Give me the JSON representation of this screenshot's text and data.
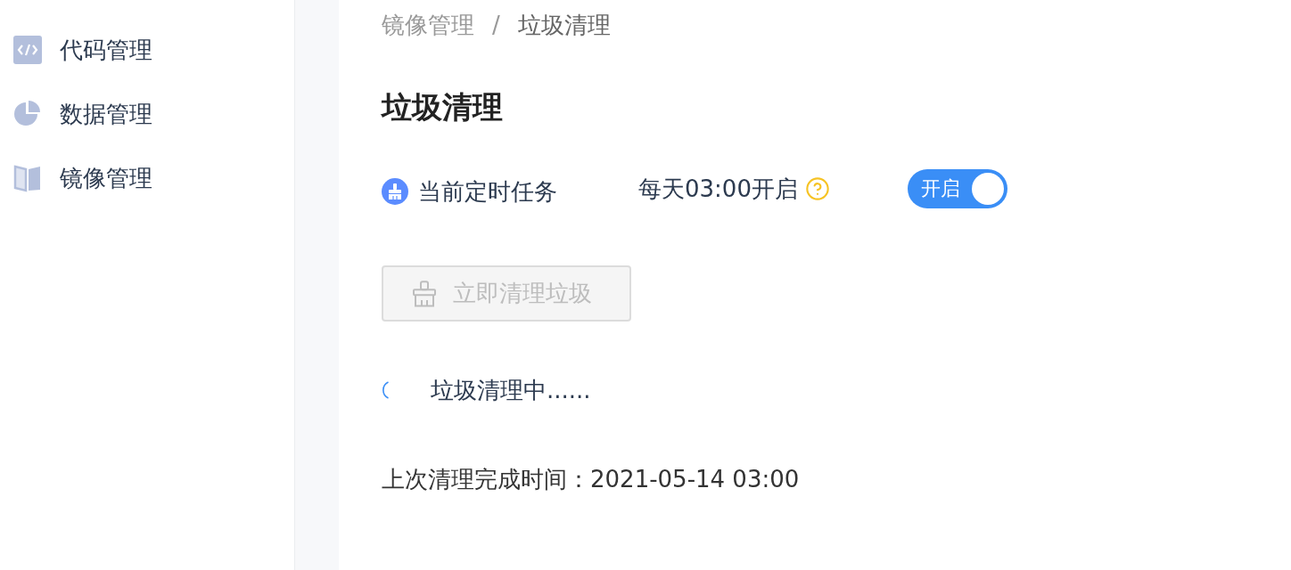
{
  "sidebar": {
    "items": [
      {
        "kind": "code",
        "label": "代码管理",
        "selected": false
      },
      {
        "kind": "chart",
        "label": "数据管理",
        "selected": false
      },
      {
        "kind": "book",
        "label": "镜像管理",
        "selected": false
      }
    ]
  },
  "breadcrumb": {
    "items": [
      "镜像管理",
      "垃圾清理"
    ],
    "separator": "/"
  },
  "title": "垃圾清理",
  "schedule": {
    "label": "当前定时任务",
    "value": "每天03:00开启",
    "switch": {
      "label": "开启",
      "on": true
    }
  },
  "clean_button": {
    "label": "立即清理垃圾",
    "disabled": true
  },
  "status": {
    "text": "垃圾清理中......",
    "loading": true
  },
  "last_cleaned": "上次清理完成时间：2021-05-14 03:00"
}
